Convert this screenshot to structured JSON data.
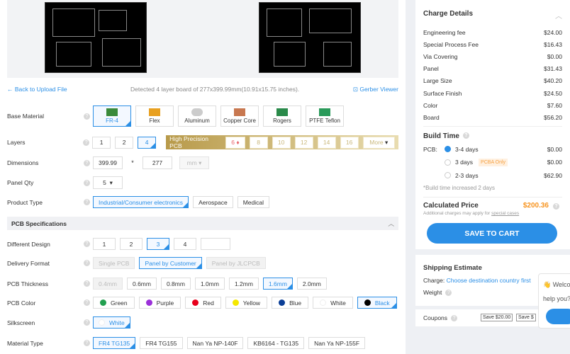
{
  "topbar": {
    "back": "Back to Upload File",
    "detected": "Detected 4 layer board of 277x399.99mm(10.91x15.75 inches).",
    "viewer": "Gerber Viewer"
  },
  "labels": {
    "base": "Base Material",
    "layers": "Layers",
    "dims": "Dimensions",
    "qty": "Panel Qty",
    "ptype": "Product Type",
    "design": "Different Design",
    "delivery": "Delivery Format",
    "thick": "PCB Thickness",
    "color": "PCB Color",
    "silk": "Silkscreen",
    "mtype": "Material Type"
  },
  "materials": [
    "FR-4",
    "Flex",
    "Aluminum",
    "Copper Core",
    "Rogers",
    "PTFE Teflon"
  ],
  "layers": [
    "1",
    "2",
    "4"
  ],
  "hp": {
    "title": "High Precision PCB",
    "options": [
      "6",
      "8",
      "10",
      "12",
      "14",
      "16"
    ],
    "more": "More"
  },
  "dims": {
    "w": "399.99",
    "sep": "*",
    "h": "277",
    "unit": "mm"
  },
  "qty": "5",
  "ptypes": [
    "Industrial/Consumer electronics",
    "Aerospace",
    "Medical"
  ],
  "section": "PCB Specifications",
  "designs": [
    "1",
    "2",
    "3",
    "4",
    ""
  ],
  "delivery": [
    "Single PCB",
    "Panel by Customer",
    "Panel by JLCPCB"
  ],
  "thickness": [
    "0.4mm",
    "0.6mm",
    "0.8mm",
    "1.0mm",
    "1.2mm",
    "1.6mm",
    "2.0mm"
  ],
  "colors": [
    {
      "n": "Green",
      "c": "#22a050"
    },
    {
      "n": "Purple",
      "c": "#9b30d9"
    },
    {
      "n": "Red",
      "c": "#e8001c"
    },
    {
      "n": "Yellow",
      "c": "#f5e800"
    },
    {
      "n": "Blue",
      "c": "#0a3e96"
    },
    {
      "n": "White",
      "c": "#ffffff"
    },
    {
      "n": "Black",
      "c": "#000000"
    }
  ],
  "silk": "White",
  "mtypes": [
    "FR4 TG135",
    "FR4 TG155",
    "Nan Ya NP-140F",
    "KB6164 - TG135",
    "Nan Ya NP-155F"
  ],
  "charges": {
    "title": "Charge Details",
    "items": [
      [
        "Engineering fee",
        "$24.00"
      ],
      [
        "Special Process Fee",
        "$16.43"
      ],
      [
        "Via Covering",
        "$0.00"
      ],
      [
        "Panel",
        "$31.43"
      ],
      [
        "Large Size",
        "$40.20"
      ],
      [
        "Surface Finish",
        "$24.50"
      ],
      [
        "Color",
        "$7.60"
      ],
      [
        "Board",
        "$56.20"
      ]
    ]
  },
  "build": {
    "title": "Build Time",
    "pcb": "PCB:",
    "options": [
      [
        "3-4 days",
        "$0.00"
      ],
      [
        "3 days",
        "$0.00"
      ],
      [
        "2-3 days",
        "$62.90"
      ]
    ],
    "badge": "PCBA Only",
    "note": "*Build time increased 2 days"
  },
  "price": {
    "label": "Calculated Price",
    "value": "$200.36",
    "note": "Additional charges may apply for ",
    "link": "special cases"
  },
  "cart": "SAVE TO CART",
  "ship": {
    "title": "Shipping Estimate",
    "charge": "Charge: ",
    "link": "Choose destination country first",
    "weight": "Weight"
  },
  "coupons": {
    "label": "Coupons",
    "c1": "Save $20.00",
    "c2": "Save $"
  },
  "chat": {
    "l1": "👋 Welco",
    "l2": "help you?"
  }
}
